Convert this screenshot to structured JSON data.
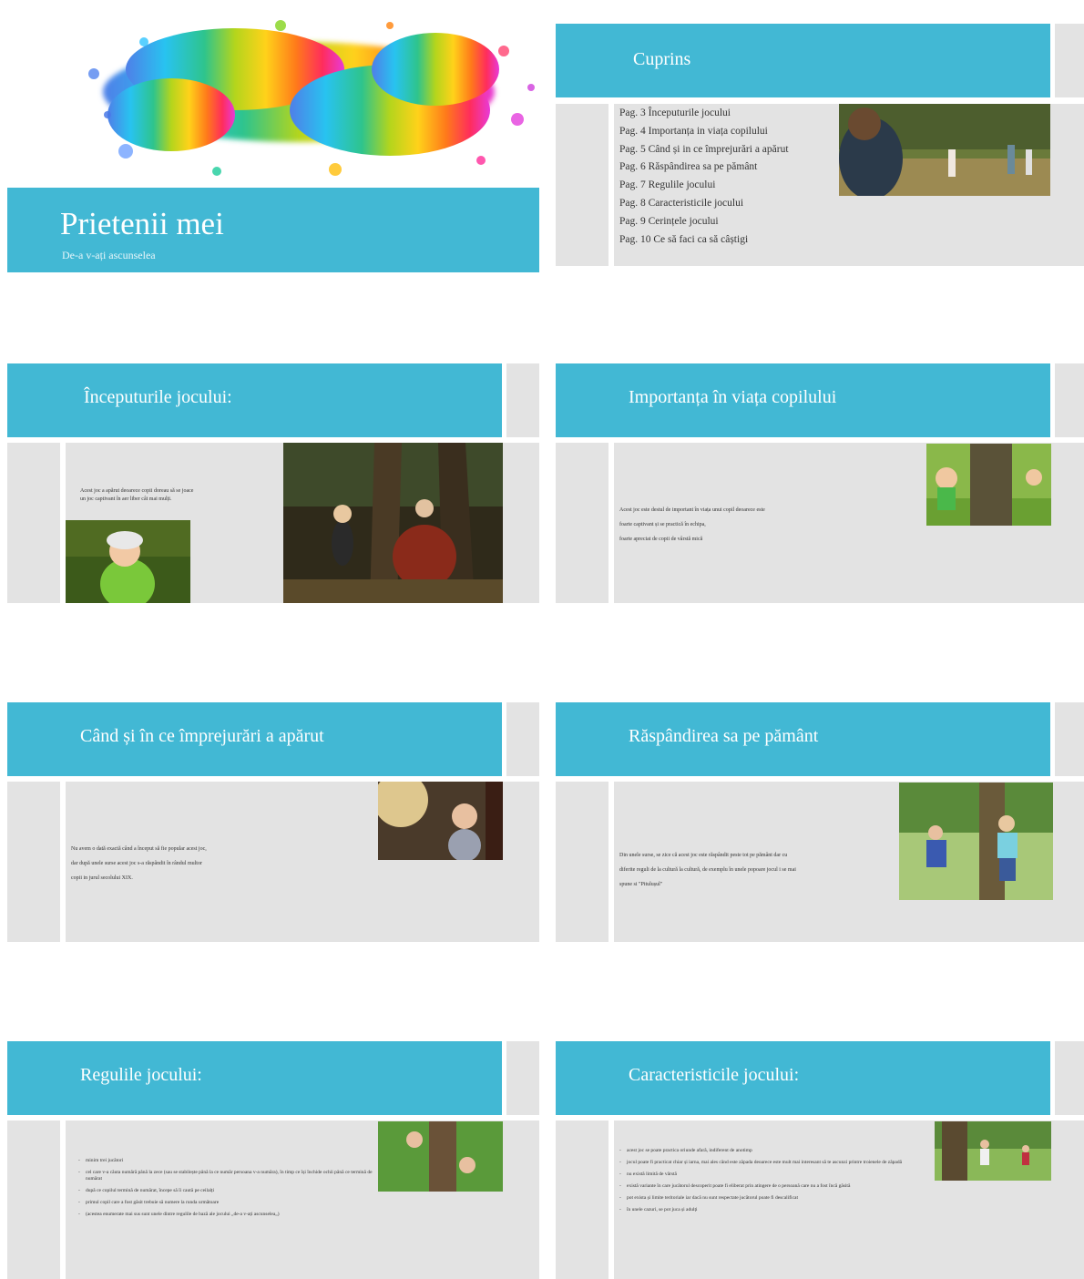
{
  "title_slide": {
    "title": "Prietenii mei",
    "subtitle": "De-a v-ați ascunselea"
  },
  "toc": {
    "heading": "Cuprins",
    "items": [
      "Pag. 3 Începuturile jocului",
      "Pag. 4 Importanța in viața copilului",
      "Pag. 5 Când și in ce împrejurări a apărut",
      "Pag. 6 Răspândirea sa pe pământ",
      "Pag. 7 Regulile jocului",
      "Pag. 8 Caracteristicile jocului",
      "Pag. 9 Cerințele jocului",
      "Pag. 10 Ce să faci ca să câștigi"
    ]
  },
  "slide3": {
    "heading": "Începuturile jocului:",
    "text": [
      "Acest joc a apărut deoarece copii doreau să se joace",
      "un joc captivant în aer liber cât mai mulți."
    ]
  },
  "slide4": {
    "heading": "Importanța în viața copilului",
    "text": [
      "Acest joc este destul de important în viața unui copil deoarece este",
      "foarte captivant și se practică în echipa,",
      "foarte apreciat de copii de vârstă mică"
    ]
  },
  "slide5": {
    "heading": "Când și în ce împrejurări a apărut",
    "text": [
      "Nu avem o dată exactă când a început să fie popular acest joc,",
      "dar după unele surse acest joc s-a răspândit în rândul multor",
      "copii in jurul secolului XIX."
    ]
  },
  "slide6": {
    "heading": "Răspândirea sa pe pământ",
    "text": [
      "Din unele surse, se zice că acest joc este răspândit peste tot pe pământ dar cu",
      "diferite reguli de la cultură la cultură, de exemplu în unele popoare jocul i se mai",
      "spune si \"Pitulușul\""
    ]
  },
  "slide7": {
    "heading": "Regulile jocului:",
    "items": [
      "minim trei jucători",
      "cel care v-a căuta numără până la zece (sau se stabilește până la ce număr persoana v-a număra), în timp ce își închide ochii până ce termină de numărat",
      "după ce copilul termină de numărat, începe să îi caută pe ceilalți",
      "primul copil care a fost găsit trebuie să numere la runda următoare",
      "(acestea enumerate mai sus sunt unele dintre regulile de bază ale jocului „de-a v-ați ascunselea„)"
    ]
  },
  "slide8": {
    "heading": "Caracteristicile jocului:",
    "items": [
      "acest joc se poate practica oriunde afară, indiferent de anotimp",
      "jocul poate fi practicat chiar și iarna, mai ales când este zăpada deoarece este mult mai interesant să te ascunzi printre troienele de zăpadă",
      "nu există limită de vârstă",
      "există variante în care jucătorul descoperit poate fi eliberat prin atingere de o persoană care nu a fost încă găsită",
      "pot exista și limite teritoriale iar dacă nu sunt respectate jucătorul poate fi descalificat",
      "în unele cazuri, se pot juca și adulți"
    ]
  },
  "colors": {
    "accent": "#42b8d4",
    "panel": "#e3e3e3"
  }
}
